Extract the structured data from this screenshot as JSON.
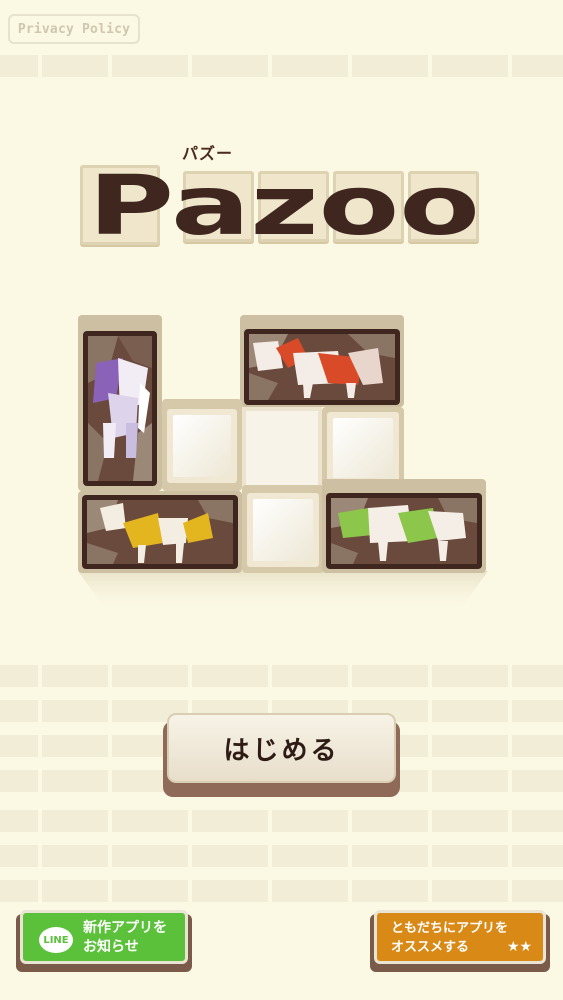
{
  "header": {
    "privacy_label": "Privacy Policy"
  },
  "logo": {
    "kana": "パズー",
    "title": "Pazoo"
  },
  "board": {
    "animals": [
      "elephant",
      "bull",
      "goat",
      "cow"
    ],
    "colors": {
      "elephant": "#8a62b8",
      "bull": "#d84a28",
      "goat": "#e3b51e",
      "cow": "#8cc64a",
      "stone": "#6b4a3e",
      "frame": "#3f2720"
    }
  },
  "buttons": {
    "start_label": "はじめる",
    "line_badge": "LINE",
    "line_label_1": "新作アプリを",
    "line_label_2": "お知らせ",
    "share_label_1": "ともだちにアプリを",
    "share_label_2": "オススメする",
    "share_stars": "★★"
  },
  "colors": {
    "background": "#fbf8e4",
    "line_green": "#5bc13a",
    "share_orange": "#d98a16",
    "brown": "#3f2720"
  }
}
